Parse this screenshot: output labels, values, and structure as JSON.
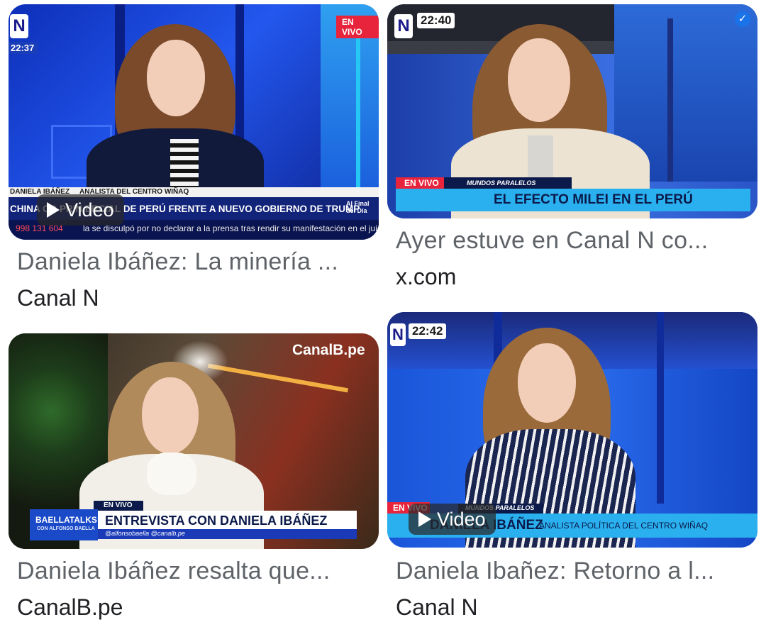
{
  "results": [
    {
      "title": "Daniela Ibáñez: La minería ...",
      "source": "Canal N",
      "is_video": true,
      "video_label": "Video",
      "thumb": {
        "live_label": "EN VIVO",
        "clock": "22:37",
        "name_strip": "DANIELA IBÁÑEZ",
        "role_strip": "ANALISTA DEL CENTRO WIÑAQ",
        "headline": "CHINA CO PRIN   ERCIAL DE PERÚ FRENTE A NUEVO GOBIERNO DE TRUMP",
        "program": "Al Final del Día",
        "phone": "998 131 604",
        "ticker": "la se disculpó por no declarar a la prensa tras rendir su manifestación en el juicio",
        "logo": "N"
      }
    },
    {
      "title": "Ayer estuve en Canal N co...",
      "source": "x.com",
      "is_video": false,
      "thumb": {
        "clock": "22:40",
        "live_label": "EN VIVO",
        "program": "MUNDOS PARALELOS",
        "headline": "EL EFECTO MILEI EN EL PERÚ",
        "logo": "N"
      }
    },
    {
      "title": "Daniela Ibáñez resalta que...",
      "source": "CanalB.pe",
      "is_video": false,
      "thumb": {
        "brand": "CanalB.pe",
        "live_label": "EN VIVO",
        "show": "BAELLATALKS",
        "show_sub": "CON ALFONSO BAELLA",
        "headline": "ENTREVISTA CON DANIELA IBÁÑEZ",
        "handles": "@alfonsobaella @canalb.pe"
      }
    },
    {
      "title": "Daniela Ibañez: Retorno a l...",
      "source": "Canal N",
      "is_video": true,
      "video_label": "Video",
      "thumb": {
        "clock": "22:42",
        "live_label": "EN VIVO",
        "program": "MUNDOS PARALELOS",
        "name_strip": "DANIELA IBÁÑEZ",
        "role_strip": "ANALISTA POLÍTICA DEL CENTRO WIÑAQ",
        "logo": "N"
      }
    }
  ],
  "colors": {
    "canal_n_blue": "#1f3fd6",
    "live_red": "#e8243c",
    "banner_cyan": "#1fa9e6",
    "title_gray": "#5f6368",
    "source_black": "#202124"
  }
}
